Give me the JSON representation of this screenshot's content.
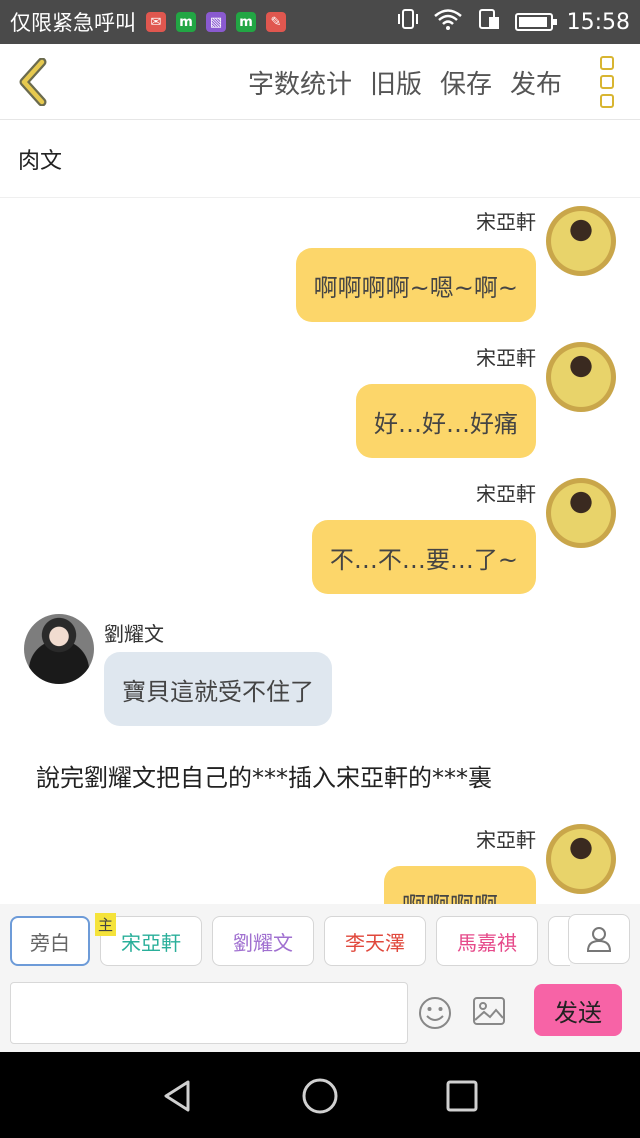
{
  "status_bar": {
    "carrier_text": "仅限紧急呼叫",
    "notification_icons": [
      {
        "name": "mail-notification-icon",
        "color": "#e0574f",
        "glyph": "✉"
      },
      {
        "name": "m-app-icon",
        "color": "#22a644",
        "glyph": "m"
      },
      {
        "name": "gallery-notification-icon",
        "color": "#8a5ad0",
        "glyph": "▧"
      },
      {
        "name": "m-app-icon-2",
        "color": "#22a644",
        "glyph": "m"
      },
      {
        "name": "app-notification-icon",
        "color": "#e0574f",
        "glyph": "✎"
      }
    ],
    "time": "15:58"
  },
  "top_bar": {
    "actions": [
      "字数统计",
      "旧版",
      "保存",
      "发布"
    ]
  },
  "title": "肉文",
  "messages": [
    {
      "side": "right",
      "name": "宋亞軒",
      "text": "啊啊啊啊~嗯~啊~",
      "avatar": "yellow"
    },
    {
      "side": "right",
      "name": "宋亞軒",
      "text": "好…好…好痛",
      "avatar": "yellow"
    },
    {
      "side": "right",
      "name": "宋亞軒",
      "text": "不…不…要…了~",
      "avatar": "yellow"
    },
    {
      "side": "left",
      "name": "劉耀文",
      "text": "寶貝這就受不住了",
      "avatar": "dark"
    },
    {
      "type": "narration",
      "text": "說完劉耀文把自己的***插入宋亞軒的***裏"
    },
    {
      "side": "right",
      "name": "宋亞軒",
      "text": "啊啊啊啊~",
      "avatar": "yellow"
    }
  ],
  "characters": {
    "narrator": "旁白",
    "main_tag": "主",
    "list": [
      {
        "name": "宋亞軒",
        "color": "#2aaf9a"
      },
      {
        "name": "劉耀文",
        "color": "#a070d0"
      },
      {
        "name": "李天澤",
        "color": "#e0483c"
      },
      {
        "name": "馬嘉祺",
        "color": "#e64a8a"
      }
    ]
  },
  "composer": {
    "input_value": "",
    "input_placeholder": "",
    "send_label": "发送"
  },
  "colors": {
    "accent_yellow": "#fcd66a",
    "icon_gold": "#d8b531",
    "send_pink": "#f763a6",
    "bubble_grey": "#dfe7ef"
  }
}
